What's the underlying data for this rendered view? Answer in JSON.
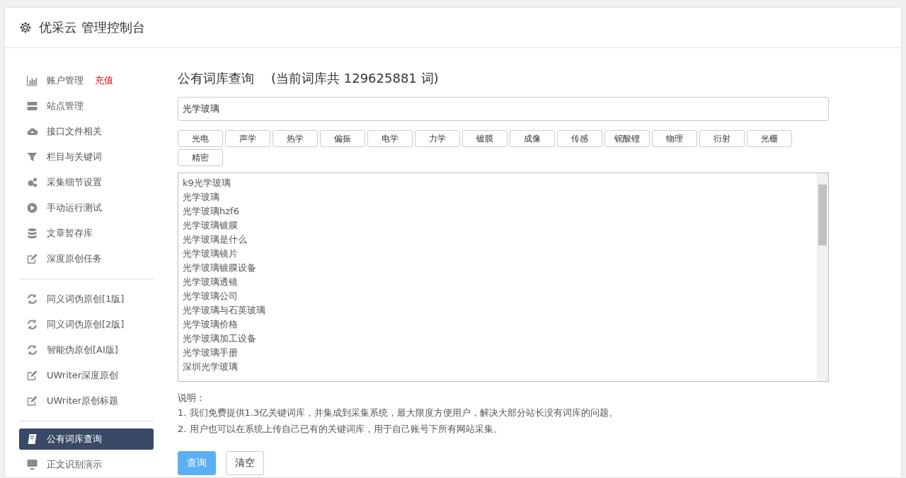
{
  "header": {
    "title": "优采云 管理控制台"
  },
  "sidebar": {
    "groups": [
      {
        "items": [
          {
            "kind": "chart",
            "label": "账户管理",
            "badge": "充值",
            "selected": false
          },
          {
            "kind": "server",
            "label": "站点管理",
            "selected": false
          },
          {
            "kind": "cloud",
            "label": "接口文件相关",
            "selected": false
          },
          {
            "kind": "filter",
            "label": "栏目与关键词",
            "selected": false
          },
          {
            "kind": "gears",
            "label": "采集细节设置",
            "selected": false
          },
          {
            "kind": "play",
            "label": "手动运行测试",
            "selected": false
          },
          {
            "kind": "database",
            "label": "文章暂存库",
            "selected": false
          },
          {
            "kind": "edit",
            "label": "深度原创任务",
            "selected": false
          }
        ]
      },
      {
        "items": [
          {
            "kind": "refresh",
            "label": "同义词伪原创[1版]",
            "selected": false
          },
          {
            "kind": "refresh",
            "label": "同义词伪原创[2版]",
            "selected": false
          },
          {
            "kind": "refresh",
            "label": "智能伪原创[AI版]",
            "selected": false
          },
          {
            "kind": "edit",
            "label": "UWriter深度原创",
            "selected": false
          },
          {
            "kind": "edit",
            "label": "UWriter原创标题",
            "selected": false
          }
        ]
      },
      {
        "items": [
          {
            "kind": "book",
            "label": "公有词库查询",
            "selected": true
          },
          {
            "kind": "monitor",
            "label": "正文识别演示",
            "selected": false
          }
        ]
      }
    ]
  },
  "main": {
    "title": "公有词库查询",
    "count_note": "(当前词库共 129625881 词)",
    "search": {
      "value": "光学玻璃"
    },
    "tags": [
      "光电",
      "声学",
      "热学",
      "偏振",
      "电学",
      "力学",
      "镀膜",
      "成像",
      "传感",
      "铌酸锂",
      "物理",
      "衍射",
      "光栅",
      "精密"
    ],
    "results": [
      "k9光学玻璃",
      "光学玻璃",
      "光学玻璃hzf6",
      "光学玻璃镀膜",
      "光学玻璃是什么",
      "光学玻璃镜片",
      "光学玻璃镀膜设备",
      "光学玻璃透镜",
      "光学玻璃公司",
      "光学玻璃与石英玻璃",
      "光学玻璃价格",
      "光学玻璃加工设备",
      "光学玻璃手册",
      "深圳光学玻璃"
    ],
    "notes_title": "说明：",
    "notes": [
      "1. 我们免费提供1.3亿关键词库，并集成到采集系统，最大限度方便用户，解决大部分站长没有词库的问题。",
      "2. 用户也可以在系统上传自己已有的关键词库，用于自己账号下所有网站采集。"
    ],
    "buttons": [
      {
        "label": "查询",
        "kind": "primary"
      },
      {
        "label": "清空",
        "kind": "default"
      }
    ]
  }
}
